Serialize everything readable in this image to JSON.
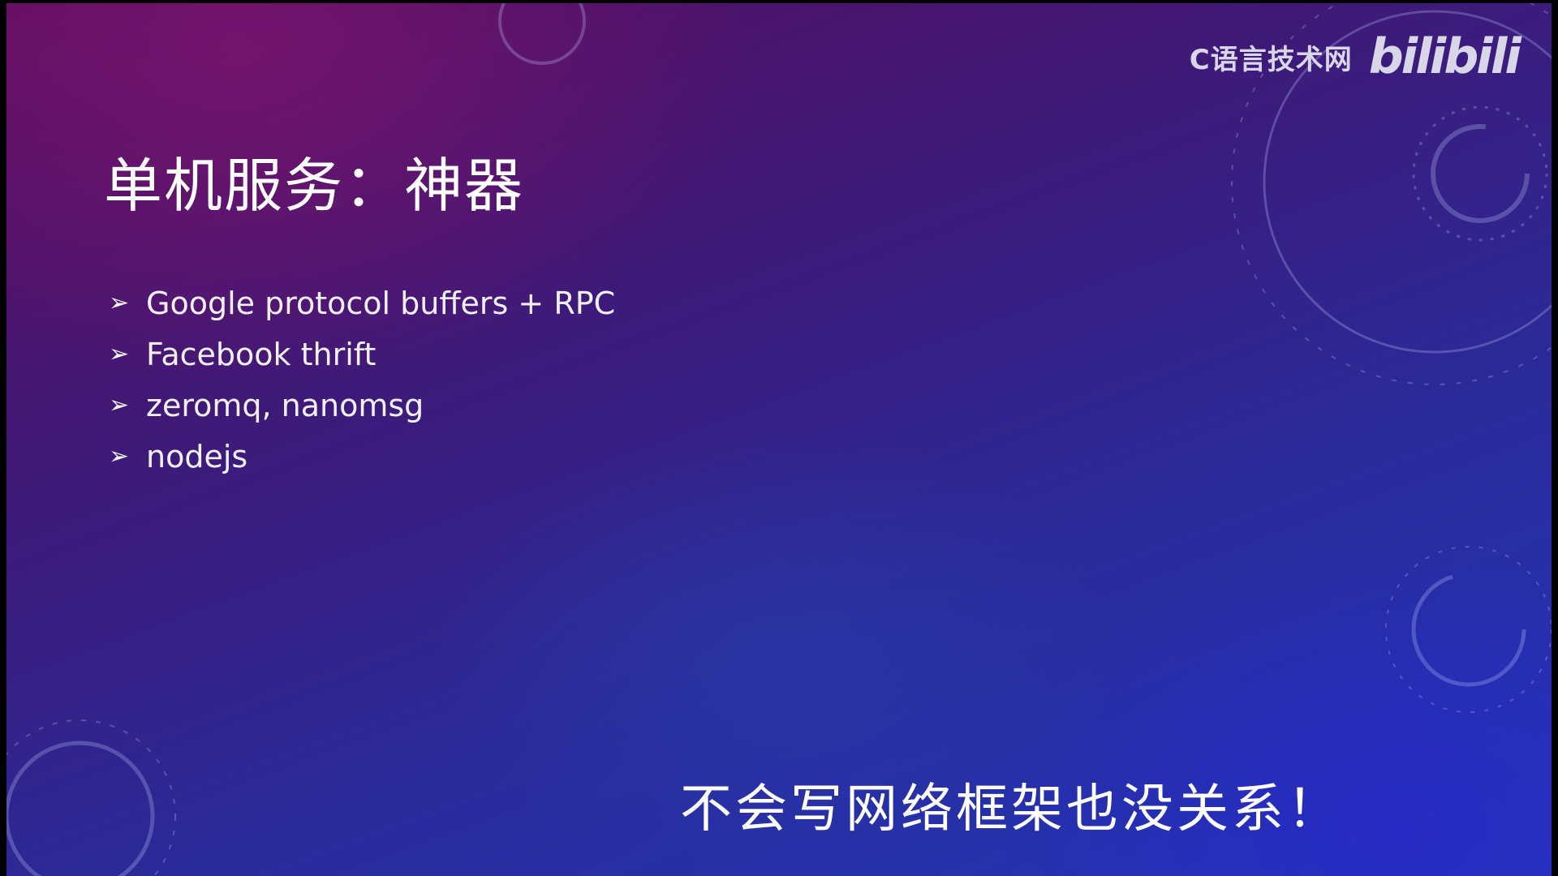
{
  "watermark": {
    "site_text": "C语言技术网",
    "logo_text": "bilibili"
  },
  "slide": {
    "title": "单机服务：神器",
    "bullet_icon": "arrowhead-bullet-icon",
    "bullet_glyph": "➢",
    "bullets": [
      "Google protocol buffers + RPC",
      "Facebook thrift",
      "zeromq, nanomsg",
      "nodejs"
    ]
  },
  "subtitle": {
    "text": "不会写网络框架也没关系！"
  },
  "colors": {
    "background_top": "#5a0d5e",
    "background_bottom": "#2236b8",
    "text": "#ffffff"
  }
}
